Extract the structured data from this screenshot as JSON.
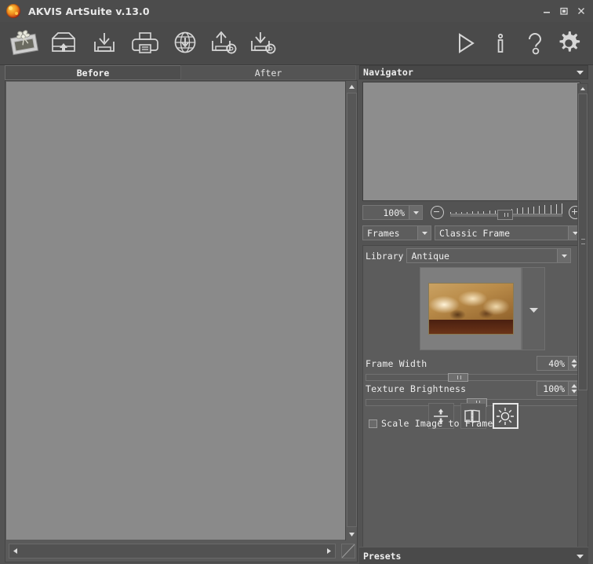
{
  "window": {
    "title": "AKVIS ArtSuite v.13.0",
    "icon": "artsuite-app-icon",
    "controls": {
      "minimize": "minimize-icon",
      "maximize": "maximize-icon",
      "close": "close-icon"
    }
  },
  "toolbar": {
    "left_tools": [
      {
        "name": "new-frame-image-icon",
        "label": "New"
      },
      {
        "name": "open-image-icon",
        "label": "Open Image"
      },
      {
        "name": "save-image-icon",
        "label": "Save Image"
      },
      {
        "name": "print-image-icon",
        "label": "Print Image"
      },
      {
        "name": "publish-web-icon",
        "label": "Publish"
      },
      {
        "name": "load-preset-icon",
        "label": "Load Preset"
      },
      {
        "name": "save-preset-icon",
        "label": "Save Preset"
      }
    ],
    "right_tools": [
      {
        "name": "run-icon",
        "label": "Run"
      },
      {
        "name": "info-icon",
        "label": "Info"
      },
      {
        "name": "help-icon",
        "label": "Help"
      },
      {
        "name": "preferences-gear-icon",
        "label": "Preferences"
      }
    ]
  },
  "tabs": {
    "before": "Before",
    "after": "After",
    "active": "Before"
  },
  "navigator": {
    "title": "Navigator",
    "collapse_icon": "chevron-down-icon",
    "zoom_value": "100%",
    "zoom_minus_icon": "minus-circle-icon",
    "zoom_plus_icon": "plus-circle-icon"
  },
  "settings": {
    "effect_group": "Frames",
    "effect_type": "Classic Frame",
    "library_label": "Library",
    "library_value": "Antique",
    "frame_preview_name": "antique-frame-thumbnail",
    "frame_next_icon": "chevron-down-icon",
    "sliders": [
      {
        "name": "Frame Width",
        "value": "40%",
        "fill": 40
      },
      {
        "name": "Texture Brightness",
        "value": "100%",
        "fill": 48
      }
    ],
    "toggles": [
      {
        "name": "flip-vertical-icon",
        "label": "Flip Vertically",
        "active": false
      },
      {
        "name": "mirror-horizontal-icon",
        "label": "Mirror",
        "active": false
      },
      {
        "name": "brightness-sun-icon",
        "label": "Brightness",
        "active": true
      }
    ],
    "checkbox": {
      "label": "Scale Image to Frame",
      "checked": false
    }
  },
  "presets": {
    "title": "Presets",
    "collapse_icon": "chevron-down-icon"
  },
  "colors": {
    "window_bg": "#535353",
    "titlebar_bg": "#4c4c4c",
    "toolbar_bg": "#4a4a4a",
    "canvas_bg": "#8a8a8a",
    "text": "#ededed",
    "accent_icon": "#f08c1c"
  }
}
